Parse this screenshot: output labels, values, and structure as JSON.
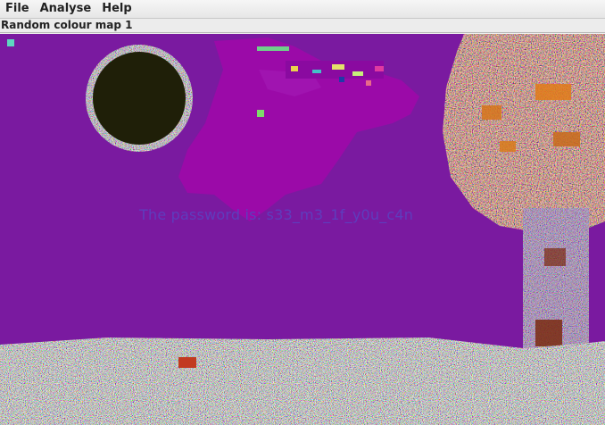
{
  "menu": {
    "items": [
      {
        "label": "File"
      },
      {
        "label": "Analyse"
      },
      {
        "label": "Help"
      }
    ]
  },
  "status": {
    "filter_name": "Random colour map 1"
  },
  "image": {
    "hidden_text": "The password is: s33_m3_1f_y0u_c4n",
    "colors": {
      "sky": "#7a1aa0",
      "cloud": "#9b0aa8",
      "sun": "#1f1f08",
      "tree_trunk": "#6a1aa0",
      "foliage": "#c8731a"
    }
  }
}
